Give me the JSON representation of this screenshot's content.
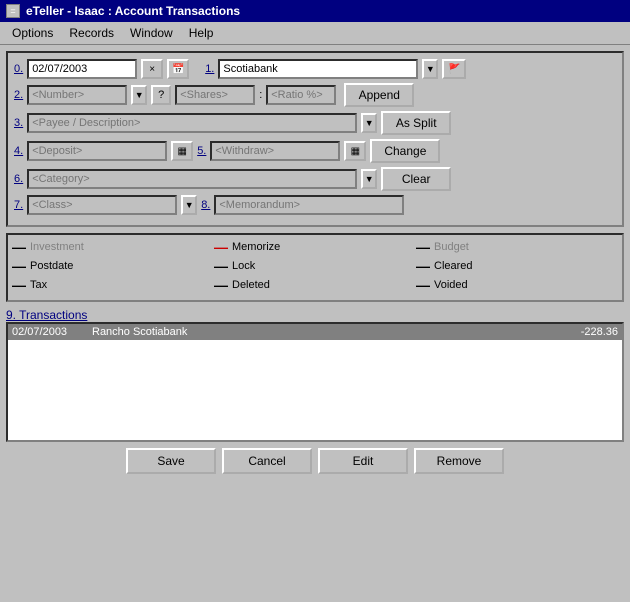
{
  "titleBar": {
    "icon": "=",
    "title": "eTeller - Isaac : Account Transactions"
  },
  "menuBar": {
    "items": [
      "Options",
      "Records",
      "Window",
      "Help"
    ]
  },
  "form": {
    "field0_label": "0.",
    "field0_value": "02/07/2003",
    "field1_label": "1.",
    "field1_value": "Scotiabank",
    "field2_label": "2.",
    "field2_placeholder": "<Number>",
    "field2b_placeholder": "<Shares>",
    "field2c_placeholder": "<Ratio %>",
    "field3_label": "3.",
    "field3_placeholder": "<Payee / Description>",
    "field4_label": "4.",
    "field4_placeholder": "<Deposit>",
    "field5_label": "5.",
    "field5_placeholder": "<Withdraw>",
    "field6_label": "6.",
    "field6_placeholder": "<Category>",
    "field7_label": "7.",
    "field7_placeholder": "<Class>",
    "field8_label": "8.",
    "field8_placeholder": "<Memorandum>",
    "btn_append": "Append",
    "btn_as_split": "As Split",
    "btn_change": "Change",
    "btn_clear": "Clear"
  },
  "statusPanel": {
    "row1": [
      {
        "dash": "—",
        "label": "Investment",
        "active": false
      },
      {
        "dash": "—",
        "label": "Memorize",
        "active": true,
        "dashColor": "red"
      },
      {
        "dash": "—",
        "label": "Budget",
        "active": false
      }
    ],
    "row2": [
      {
        "dash": "—",
        "label": "Postdate",
        "active": false
      },
      {
        "dash": "—",
        "label": "Lock",
        "active": false
      },
      {
        "dash": "—",
        "label": "Cleared",
        "active": false
      }
    ],
    "row3": [
      {
        "dash": "—",
        "label": "Tax",
        "active": false
      },
      {
        "dash": "—",
        "label": "Deleted",
        "active": false
      },
      {
        "dash": "—",
        "label": "Voided",
        "active": false
      }
    ]
  },
  "transactions": {
    "label": "9. Transactions",
    "rows": [
      {
        "date": "02/07/2003",
        "desc": "Rancho  Scotiabank",
        "amount": "-228.36"
      }
    ]
  },
  "bottomButtons": {
    "save": "Save",
    "cancel": "Cancel",
    "edit": "Edit",
    "remove": "Remove"
  }
}
